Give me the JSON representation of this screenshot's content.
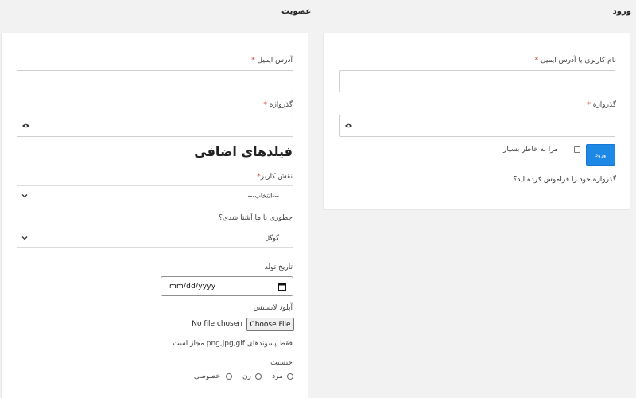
{
  "login": {
    "title": "ورود",
    "username_label": "نام کاربری یا آدرس ایمیل",
    "username_value": "",
    "password_label": "گذرواژه",
    "password_value": "",
    "remember_label": "مرا به خاطر بسپار",
    "submit_label": "ورود",
    "forgot_link": "گذرواژه خود را فراموش کرده اید؟"
  },
  "register": {
    "title": "عضویت",
    "email_label": "آدرس ایمیل",
    "email_value": "",
    "password_label": "گذرواژه",
    "password_value": "",
    "extra_title": "فیلدهای اضافی",
    "role_label": "نقش کاربر",
    "role_value": "---انتخاب---",
    "source_label": "چطوری با ما آشنا شدی؟",
    "source_value": "گوگل",
    "birthdate_label": "تاریخ تولد",
    "birthdate_placeholder": "mm/dd/yyyy",
    "license_label": "آپلود لایسنس",
    "file_button": "Choose File",
    "file_status": "No file chosen",
    "file_hint": "فقط پسوندهای png,jpg,gif مجاز است",
    "gender_label": "جنسیت",
    "gender_options": [
      "مرد",
      "زن",
      "خصوصی"
    ]
  },
  "required_mark": "*",
  "colors": {
    "accent": "#1e88e5",
    "required": "#d23b3b",
    "background": "#f2f2f2"
  },
  "icons": {
    "password_toggle": "eye-icon",
    "select_arrow": "chevron-down-icon",
    "date_picker": "calendar-icon"
  }
}
